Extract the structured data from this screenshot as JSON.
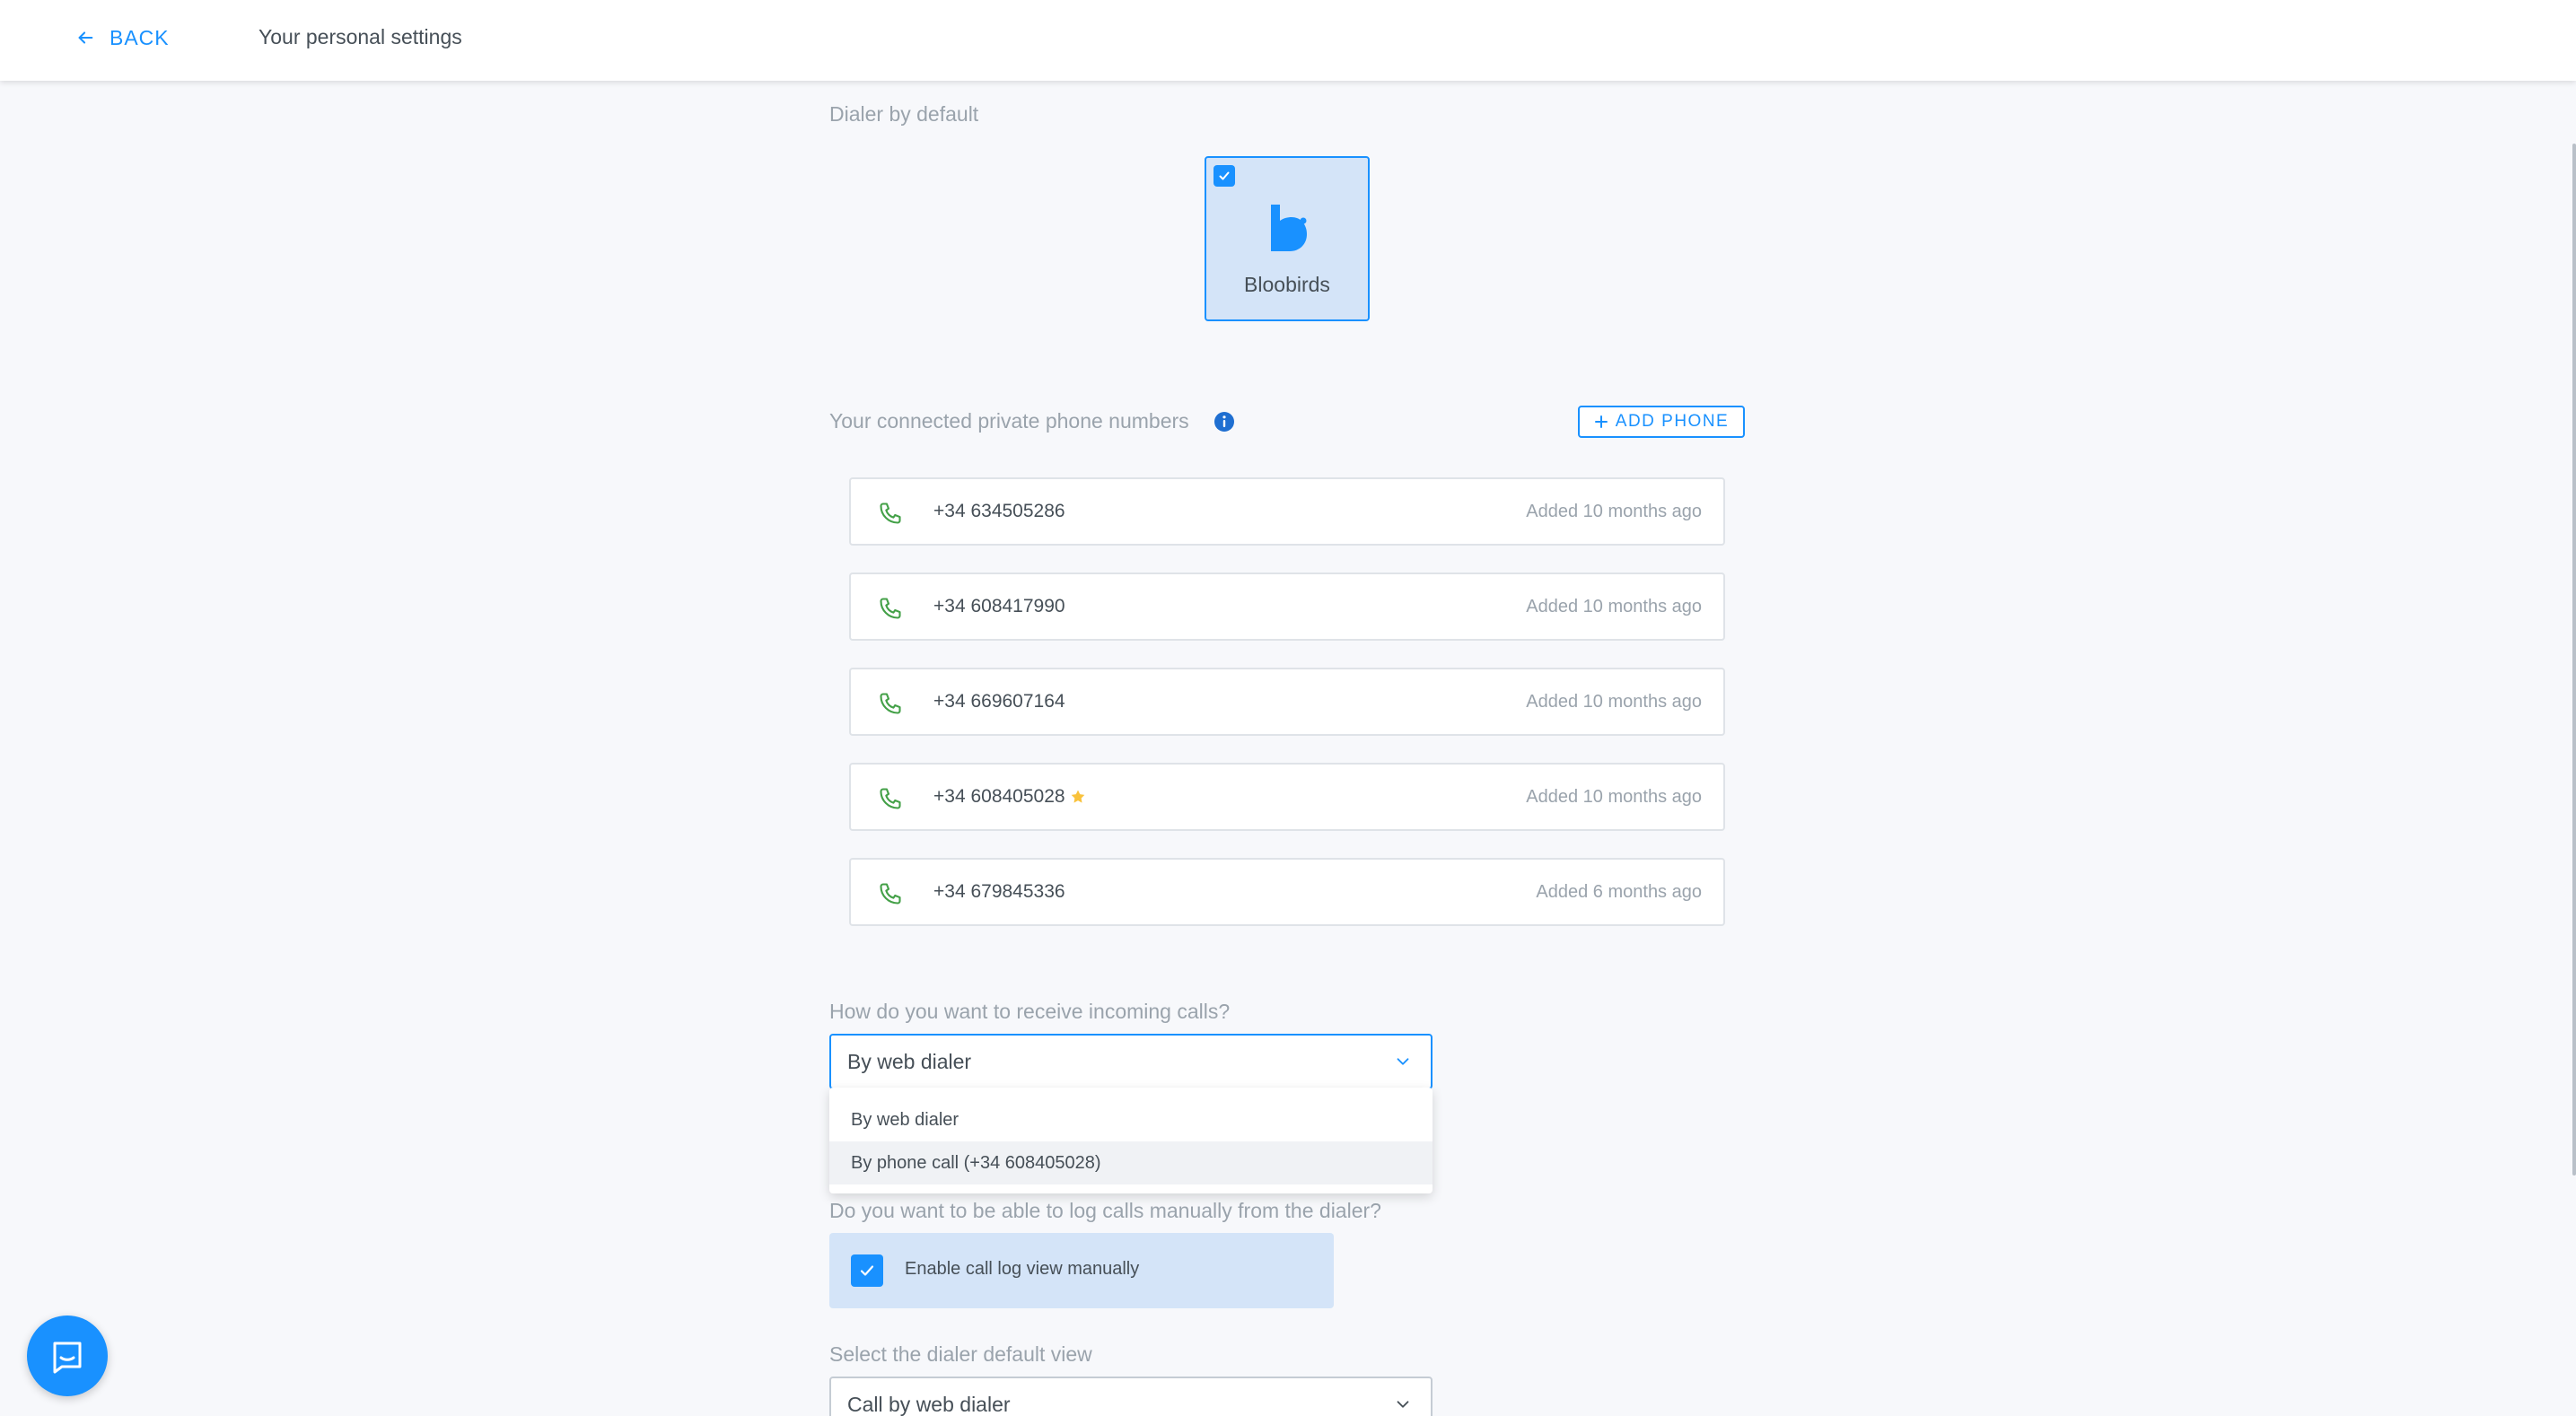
{
  "header": {
    "back_label": "BACK",
    "title": "Your personal settings"
  },
  "dialer": {
    "section_label": "Dialer by default",
    "option_name": "Bloobirds",
    "selected": true
  },
  "phones": {
    "section_label": "Your connected private phone numbers",
    "add_button_label": "ADD PHONE",
    "items": [
      {
        "number": "+34 634505286",
        "added": "Added 10 months ago",
        "default": false
      },
      {
        "number": "+34 608417990",
        "added": "Added 10 months ago",
        "default": false
      },
      {
        "number": "+34 669607164",
        "added": "Added 10 months ago",
        "default": false
      },
      {
        "number": "+34 608405028",
        "added": "Added 10 months ago",
        "default": true
      },
      {
        "number": "+34 679845336",
        "added": "Added 6 months ago",
        "default": false
      }
    ]
  },
  "incoming": {
    "question": "How do you want to receive incoming calls?",
    "selected": "By web dialer",
    "options": [
      "By web dialer",
      "By phone call (+34 608405028)"
    ]
  },
  "log_calls": {
    "question": "Do you want to be able to log calls manually from the dialer?",
    "checkbox_label": "Enable call log view manually",
    "checked": true
  },
  "default_view": {
    "question": "Select the dialer default view",
    "selected": "Call by web dialer"
  },
  "colors": {
    "accent": "#1991ff",
    "phone_icon": "#43a047",
    "star": "#f9c23c",
    "selected_bg": "#d4e4f8"
  }
}
